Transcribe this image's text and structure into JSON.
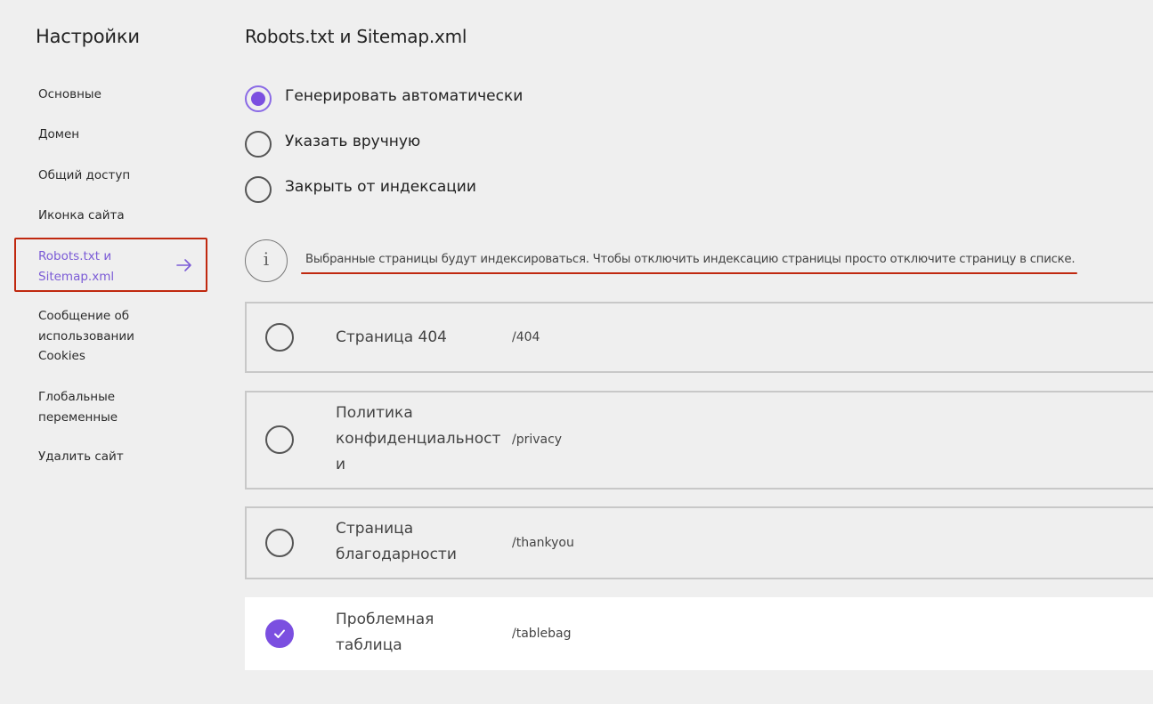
{
  "sidebar": {
    "title": "Настройки",
    "items": [
      {
        "label": "Основные"
      },
      {
        "label": "Домен"
      },
      {
        "label": "Общий доступ"
      },
      {
        "label": "Иконка сайта"
      },
      {
        "label": "Robots.txt и Sitemap.xml",
        "active": true
      },
      {
        "label": "Сообщение об использовании Cookies"
      },
      {
        "label": "Глобальные переменные"
      },
      {
        "label": "Удалить сайт"
      }
    ],
    "active_icon": "arrow-right-icon"
  },
  "main": {
    "title": "Robots.txt и Sitemap.xml",
    "options": [
      {
        "label": "Генерировать автоматически",
        "checked": true
      },
      {
        "label": "Указать вручную",
        "checked": false
      },
      {
        "label": "Закрыть от индексации",
        "checked": false
      }
    ],
    "info": {
      "icon": "info-icon",
      "icon_glyph": "i",
      "text": "Выбранные страницы будут индексироваться. Чтобы отключить индексацию страницы просто отключите страницу в списке."
    },
    "pages": [
      {
        "title": "Страница 404",
        "path": "/404",
        "enabled": false
      },
      {
        "title": "Политика конфиденциальност и",
        "path": "/privacy",
        "enabled": false
      },
      {
        "title": "Страница благодарности",
        "path": "/thankyou",
        "enabled": false
      },
      {
        "title": "Проблемная таблица",
        "path": "/tablebag",
        "enabled": true
      }
    ]
  },
  "colors": {
    "accent": "#7b4fe0",
    "highlight": "#c0280f",
    "background": "#efefef"
  }
}
